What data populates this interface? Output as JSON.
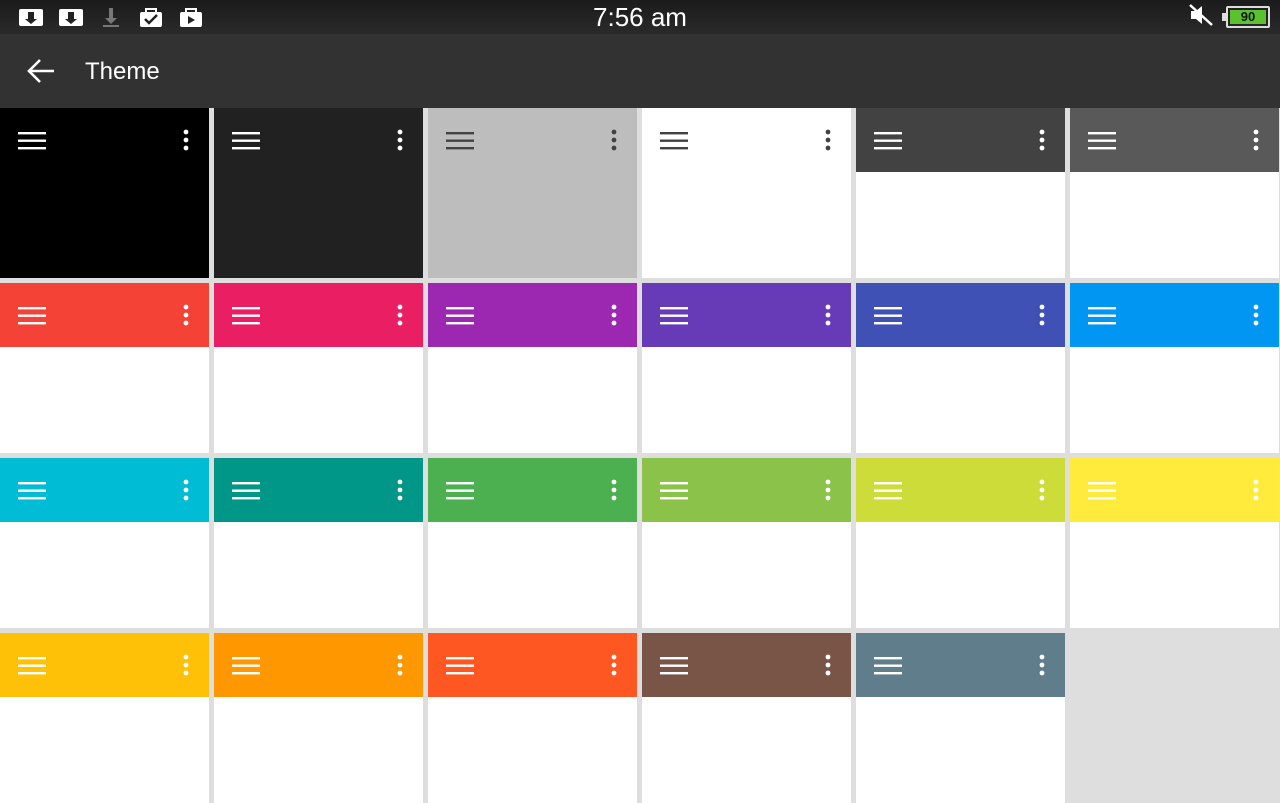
{
  "status_bar": {
    "time": "7:56 am",
    "battery_level": "90",
    "notification_icons": [
      "download-icon",
      "download-icon",
      "download-pending-icon",
      "store-icon",
      "store-icon"
    ],
    "right_icons": [
      "mute-icon",
      "battery-icon"
    ]
  },
  "app_bar": {
    "title": "Theme",
    "back_icon": "arrow-back-icon"
  },
  "themes": [
    {
      "color": "#000000",
      "full": true,
      "icon_color": "#ffffff"
    },
    {
      "color": "#212121",
      "full": true,
      "icon_color": "#ffffff"
    },
    {
      "color": "#bdbdbd",
      "full": true,
      "icon_color": "#424242"
    },
    {
      "color": "#ffffff",
      "full": true,
      "icon_color": "#424242"
    },
    {
      "color": "#424242",
      "full": false,
      "icon_color": "#ffffff"
    },
    {
      "color": "#595959",
      "full": false,
      "icon_color": "#ffffff"
    },
    {
      "color": "#f44336",
      "full": false,
      "icon_color": "#ffffff"
    },
    {
      "color": "#e91e63",
      "full": false,
      "icon_color": "#ffffff"
    },
    {
      "color": "#9c27b0",
      "full": false,
      "icon_color": "#ffffff"
    },
    {
      "color": "#673ab7",
      "full": false,
      "icon_color": "#ffffff"
    },
    {
      "color": "#3f51b5",
      "full": false,
      "icon_color": "#ffffff"
    },
    {
      "color": "#0296f3",
      "full": false,
      "icon_color": "#ffffff"
    },
    {
      "color": "#00bcd4",
      "full": false,
      "icon_color": "#ffffff"
    },
    {
      "color": "#009688",
      "full": false,
      "icon_color": "#ffffff"
    },
    {
      "color": "#4caf50",
      "full": false,
      "icon_color": "#ffffff"
    },
    {
      "color": "#8bc34a",
      "full": false,
      "icon_color": "#ffffff"
    },
    {
      "color": "#cddc39",
      "full": false,
      "icon_color": "#ffffff"
    },
    {
      "color": "#ffeb3b",
      "full": false,
      "icon_color": "#ffffff"
    },
    {
      "color": "#ffc107",
      "full": false,
      "icon_color": "#ffffff"
    },
    {
      "color": "#ff9800",
      "full": false,
      "icon_color": "#ffffff"
    },
    {
      "color": "#ff5722",
      "full": false,
      "icon_color": "#ffffff"
    },
    {
      "color": "#795548",
      "full": false,
      "icon_color": "#ffffff"
    },
    {
      "color": "#607d8b",
      "full": false,
      "icon_color": "#ffffff"
    }
  ]
}
